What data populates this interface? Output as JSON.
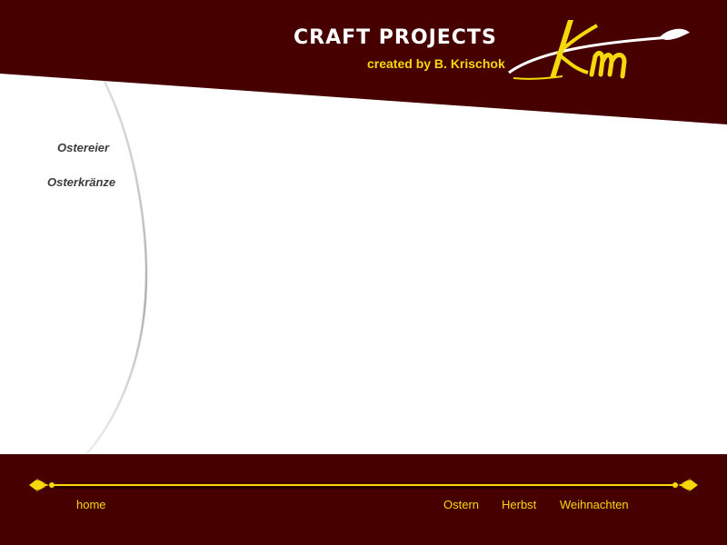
{
  "header": {
    "title": "CRAFT PROJECTS",
    "subtitle": "created by B. Krischok",
    "logo_text": "Km",
    "colors": {
      "background": "#460000",
      "title": "#ffffff",
      "accent": "#f5d90a"
    }
  },
  "sidebar": {
    "items": [
      {
        "label": "Ostereier"
      },
      {
        "label": "Osterkränze"
      }
    ]
  },
  "footer": {
    "home_label": "home",
    "links": [
      {
        "label": "Ostern"
      },
      {
        "label": "Herbst"
      },
      {
        "label": "Weihnachten"
      }
    ]
  }
}
